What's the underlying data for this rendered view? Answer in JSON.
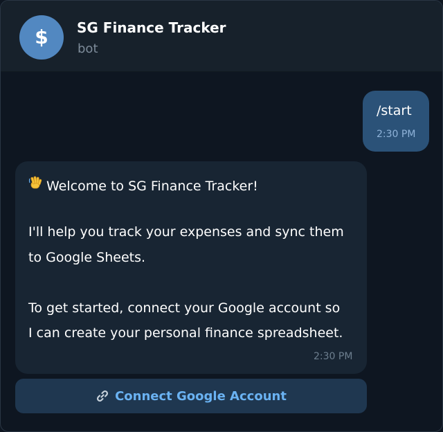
{
  "header": {
    "avatar_glyph": "$",
    "title": "SG Finance Tracker",
    "subtitle": "bot"
  },
  "messages": [
    {
      "direction": "outgoing",
      "text": "/start",
      "time": "2:30 PM"
    },
    {
      "direction": "incoming",
      "icon": "waving-hand-icon",
      "lines": [
        "Welcome to SG Finance Tracker!",
        "I'll help you track your expenses and sync them",
        "to Google Sheets.",
        "To get started, connect your Google account so",
        "I can create your personal finance spreadsheet."
      ],
      "time": "2:30 PM"
    }
  ],
  "inline_keyboard": {
    "button_icon": "link-icon",
    "button_label": "Connect Google Account"
  },
  "colors": {
    "background": "#0e1621",
    "header": "#17212b",
    "avatar": "#5288c1",
    "outgoing_bubble": "#2b5278",
    "incoming_bubble": "#182533",
    "button": "#1f3750",
    "button_text": "#6ab2f2"
  }
}
